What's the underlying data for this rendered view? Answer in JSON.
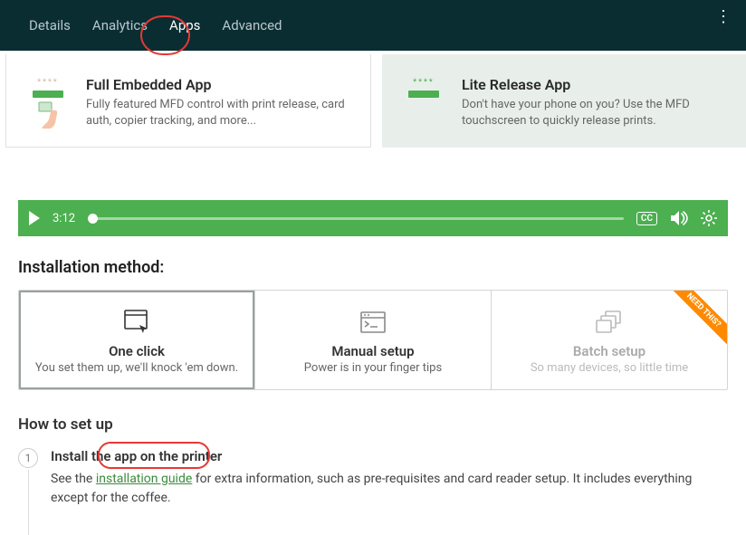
{
  "topbar": {
    "tabs": [
      "Details",
      "Analytics",
      "Apps",
      "Advanced"
    ],
    "active_index": 2
  },
  "app_cards": [
    {
      "title": "Full Embedded App",
      "desc": "Fully featured MFD control with print release, card auth, copier tracking, and more...",
      "badge_stars": "****",
      "selected": true
    },
    {
      "title": "Lite Release App",
      "desc": "Don't have your phone on you? Use the MFD touchscreen to quickly release prints.",
      "badge_stars": "****",
      "selected": false
    }
  ],
  "video": {
    "time": "3:12",
    "cc_label": "CC"
  },
  "install_method": {
    "heading": "Installation method:",
    "options": [
      {
        "title": "One click",
        "subtitle": "You set them up, we'll knock 'em down.",
        "selected": true
      },
      {
        "title": "Manual setup",
        "subtitle": "Power is in your finger tips",
        "selected": false
      },
      {
        "title": "Batch setup",
        "subtitle": "So many devices, so little time",
        "selected": false,
        "disabled": true,
        "ribbon": "NEED THIS?"
      }
    ]
  },
  "howto": {
    "heading": "How to set up",
    "steps": [
      {
        "num": "1",
        "title": "Install the app on the printer",
        "desc_before": "See the ",
        "link_text": "installation guide",
        "desc_after": " for extra information, such as pre-requisites and card reader setup. It includes everything except for the coffee."
      }
    ]
  }
}
